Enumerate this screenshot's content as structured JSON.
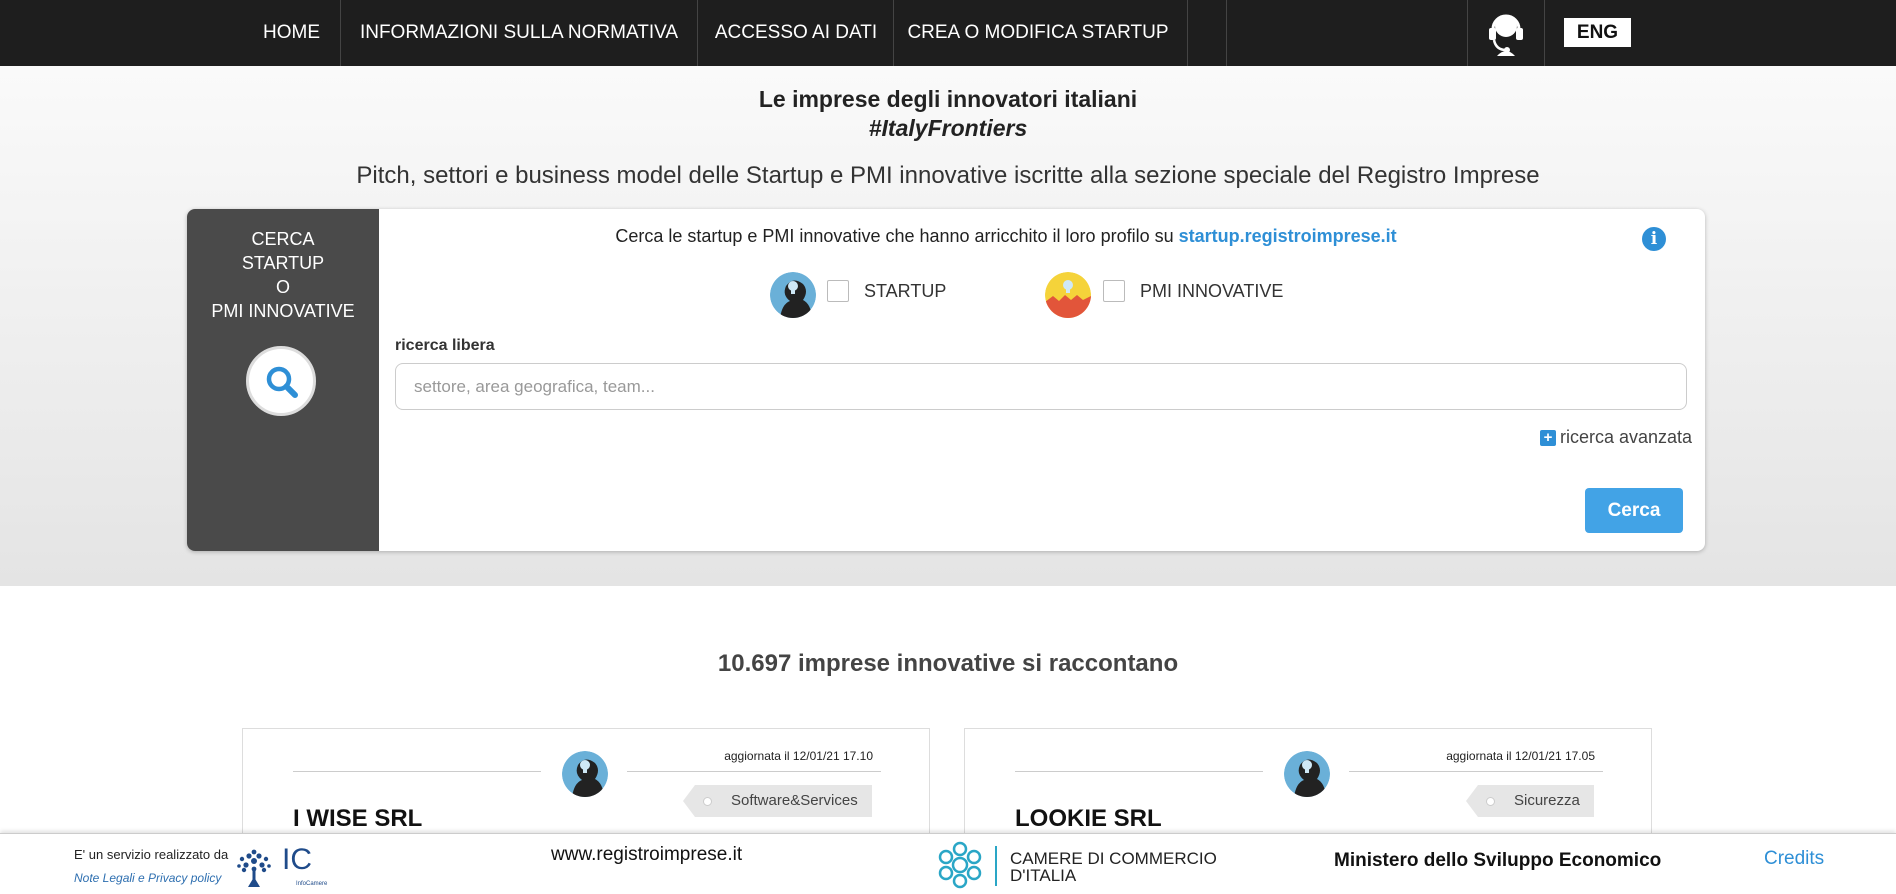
{
  "nav": {
    "items": [
      {
        "label": "HOME"
      },
      {
        "label": "INFORMAZIONI SULLA NORMATIVA"
      },
      {
        "label": "ACCESSO AI DATI"
      },
      {
        "label": "CREA O MODIFICA STARTUP"
      }
    ],
    "support_icon": "headset-icon",
    "lang_button": "ENG"
  },
  "hero": {
    "title": "Le imprese degli innovatori italiani",
    "hashtag": "#ItalyFrontiers",
    "subtitle": "Pitch, settori e business model delle Startup e PMI innovative iscritte alla sezione speciale del Registro Imprese"
  },
  "search": {
    "side_title": [
      "CERCA",
      "STARTUP",
      "O",
      "PMI INNOVATIVE"
    ],
    "side_icon": "search-icon",
    "intro_text": "Cerca le startup e PMI innovative che hanno arricchito il loro profilo su ",
    "intro_link": "startup.registroimprese.it",
    "info_icon": "info-icon",
    "filters": [
      {
        "label": "STARTUP",
        "checked": false,
        "icon": "startup-avatar-icon"
      },
      {
        "label": "PMI INNOVATIVE",
        "checked": false,
        "icon": "pmi-avatar-icon"
      }
    ],
    "free_label": "ricerca libera",
    "free_placeholder": "settore, area geografica, team...",
    "free_value": "",
    "advanced_label": "ricerca avanzata",
    "submit_label": "Cerca"
  },
  "results": {
    "count_text": "10.697 imprese innovative si raccontano",
    "cards": [
      {
        "updated": "aggiornata il 12/01/21 17.10",
        "tag": "Software&Services",
        "name": "I WISE SRL"
      },
      {
        "updated": "aggiornata il 12/01/21 17.05",
        "tag": "Sicurezza",
        "name": "LOOKIE SRL"
      }
    ]
  },
  "footer": {
    "made_by": "E' un servizio realizzato da",
    "legal_link": "Note Legali e Privacy policy",
    "infocamere_logo": "IC",
    "infocamere_small": "InfoCamere",
    "site": "www.registroimprese.it",
    "camere": [
      "CAMERE DI COMMERCIO",
      "D'ITALIA"
    ],
    "ministry": "Ministero dello Sviluppo Economico",
    "credits": "Credits"
  },
  "colors": {
    "nav_bg": "#1e1e1e",
    "accent": "#2e8fd6",
    "button": "#42a3e6",
    "panel_dark": "#4a4a4a"
  }
}
